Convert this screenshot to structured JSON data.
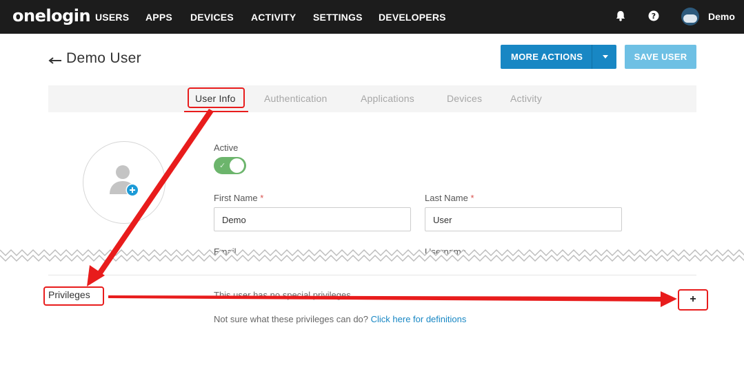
{
  "nav": {
    "logo": "onelogin",
    "items": [
      "USERS",
      "APPS",
      "DEVICES",
      "ACTIVITY",
      "SETTINGS",
      "DEVELOPERS"
    ],
    "user_name": "Demo",
    "icons": [
      "bell-icon",
      "help-icon",
      "user-avatar"
    ]
  },
  "header": {
    "title": "Demo User",
    "more_actions": "MORE ACTIONS",
    "save_user": "SAVE USER"
  },
  "tabs": [
    "User Info",
    "Authentication",
    "Applications",
    "Devices",
    "Activity"
  ],
  "active_tab": "User Info",
  "form": {
    "active_label": "Active",
    "active_value": true,
    "first_name_label": "First Name",
    "first_name_value": "Demo",
    "last_name_label": "Last Name",
    "last_name_value": "User",
    "required_marker": "*",
    "email_label": "Email",
    "username_label": "Username"
  },
  "privileges": {
    "label": "Privileges",
    "status": "This user has no special privileges",
    "help_text": "Not sure what these privileges can do?",
    "help_link": "Click here for definitions",
    "add_button": "+"
  },
  "colors": {
    "nav_bg": "#1c1c1c",
    "primary": "#1887c4",
    "primary_light": "#6ec0e4",
    "toggle_on": "#6cb56c",
    "annotation": "#e81c1c"
  }
}
